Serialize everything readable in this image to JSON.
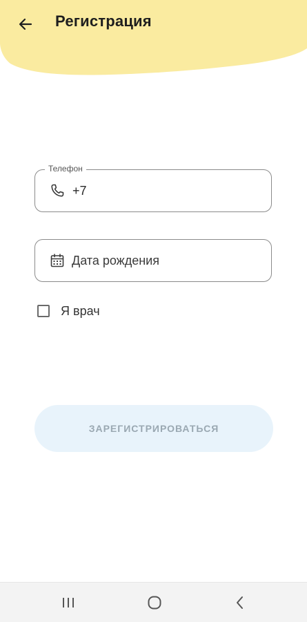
{
  "header": {
    "title": "Регистрация",
    "accent_color": "#faeba0",
    "back_icon": "arrow-left-icon"
  },
  "form": {
    "phone": {
      "label": "Телефон",
      "value": "+7",
      "icon": "phone-icon"
    },
    "birth_date": {
      "placeholder": "Дата рождения",
      "icon": "calendar-icon"
    },
    "doctor_checkbox": {
      "label": "Я врач",
      "checked": false
    },
    "submit": {
      "label": "ЗАРЕГИСТРИРОВАТЬСЯ",
      "enabled": false,
      "background": "#e8f3fb",
      "text_color": "#9aa8b2"
    }
  },
  "system_nav": {
    "recent_icon": "recent-apps-icon",
    "home_icon": "home-circle-icon",
    "back_icon": "chevron-left-icon"
  }
}
